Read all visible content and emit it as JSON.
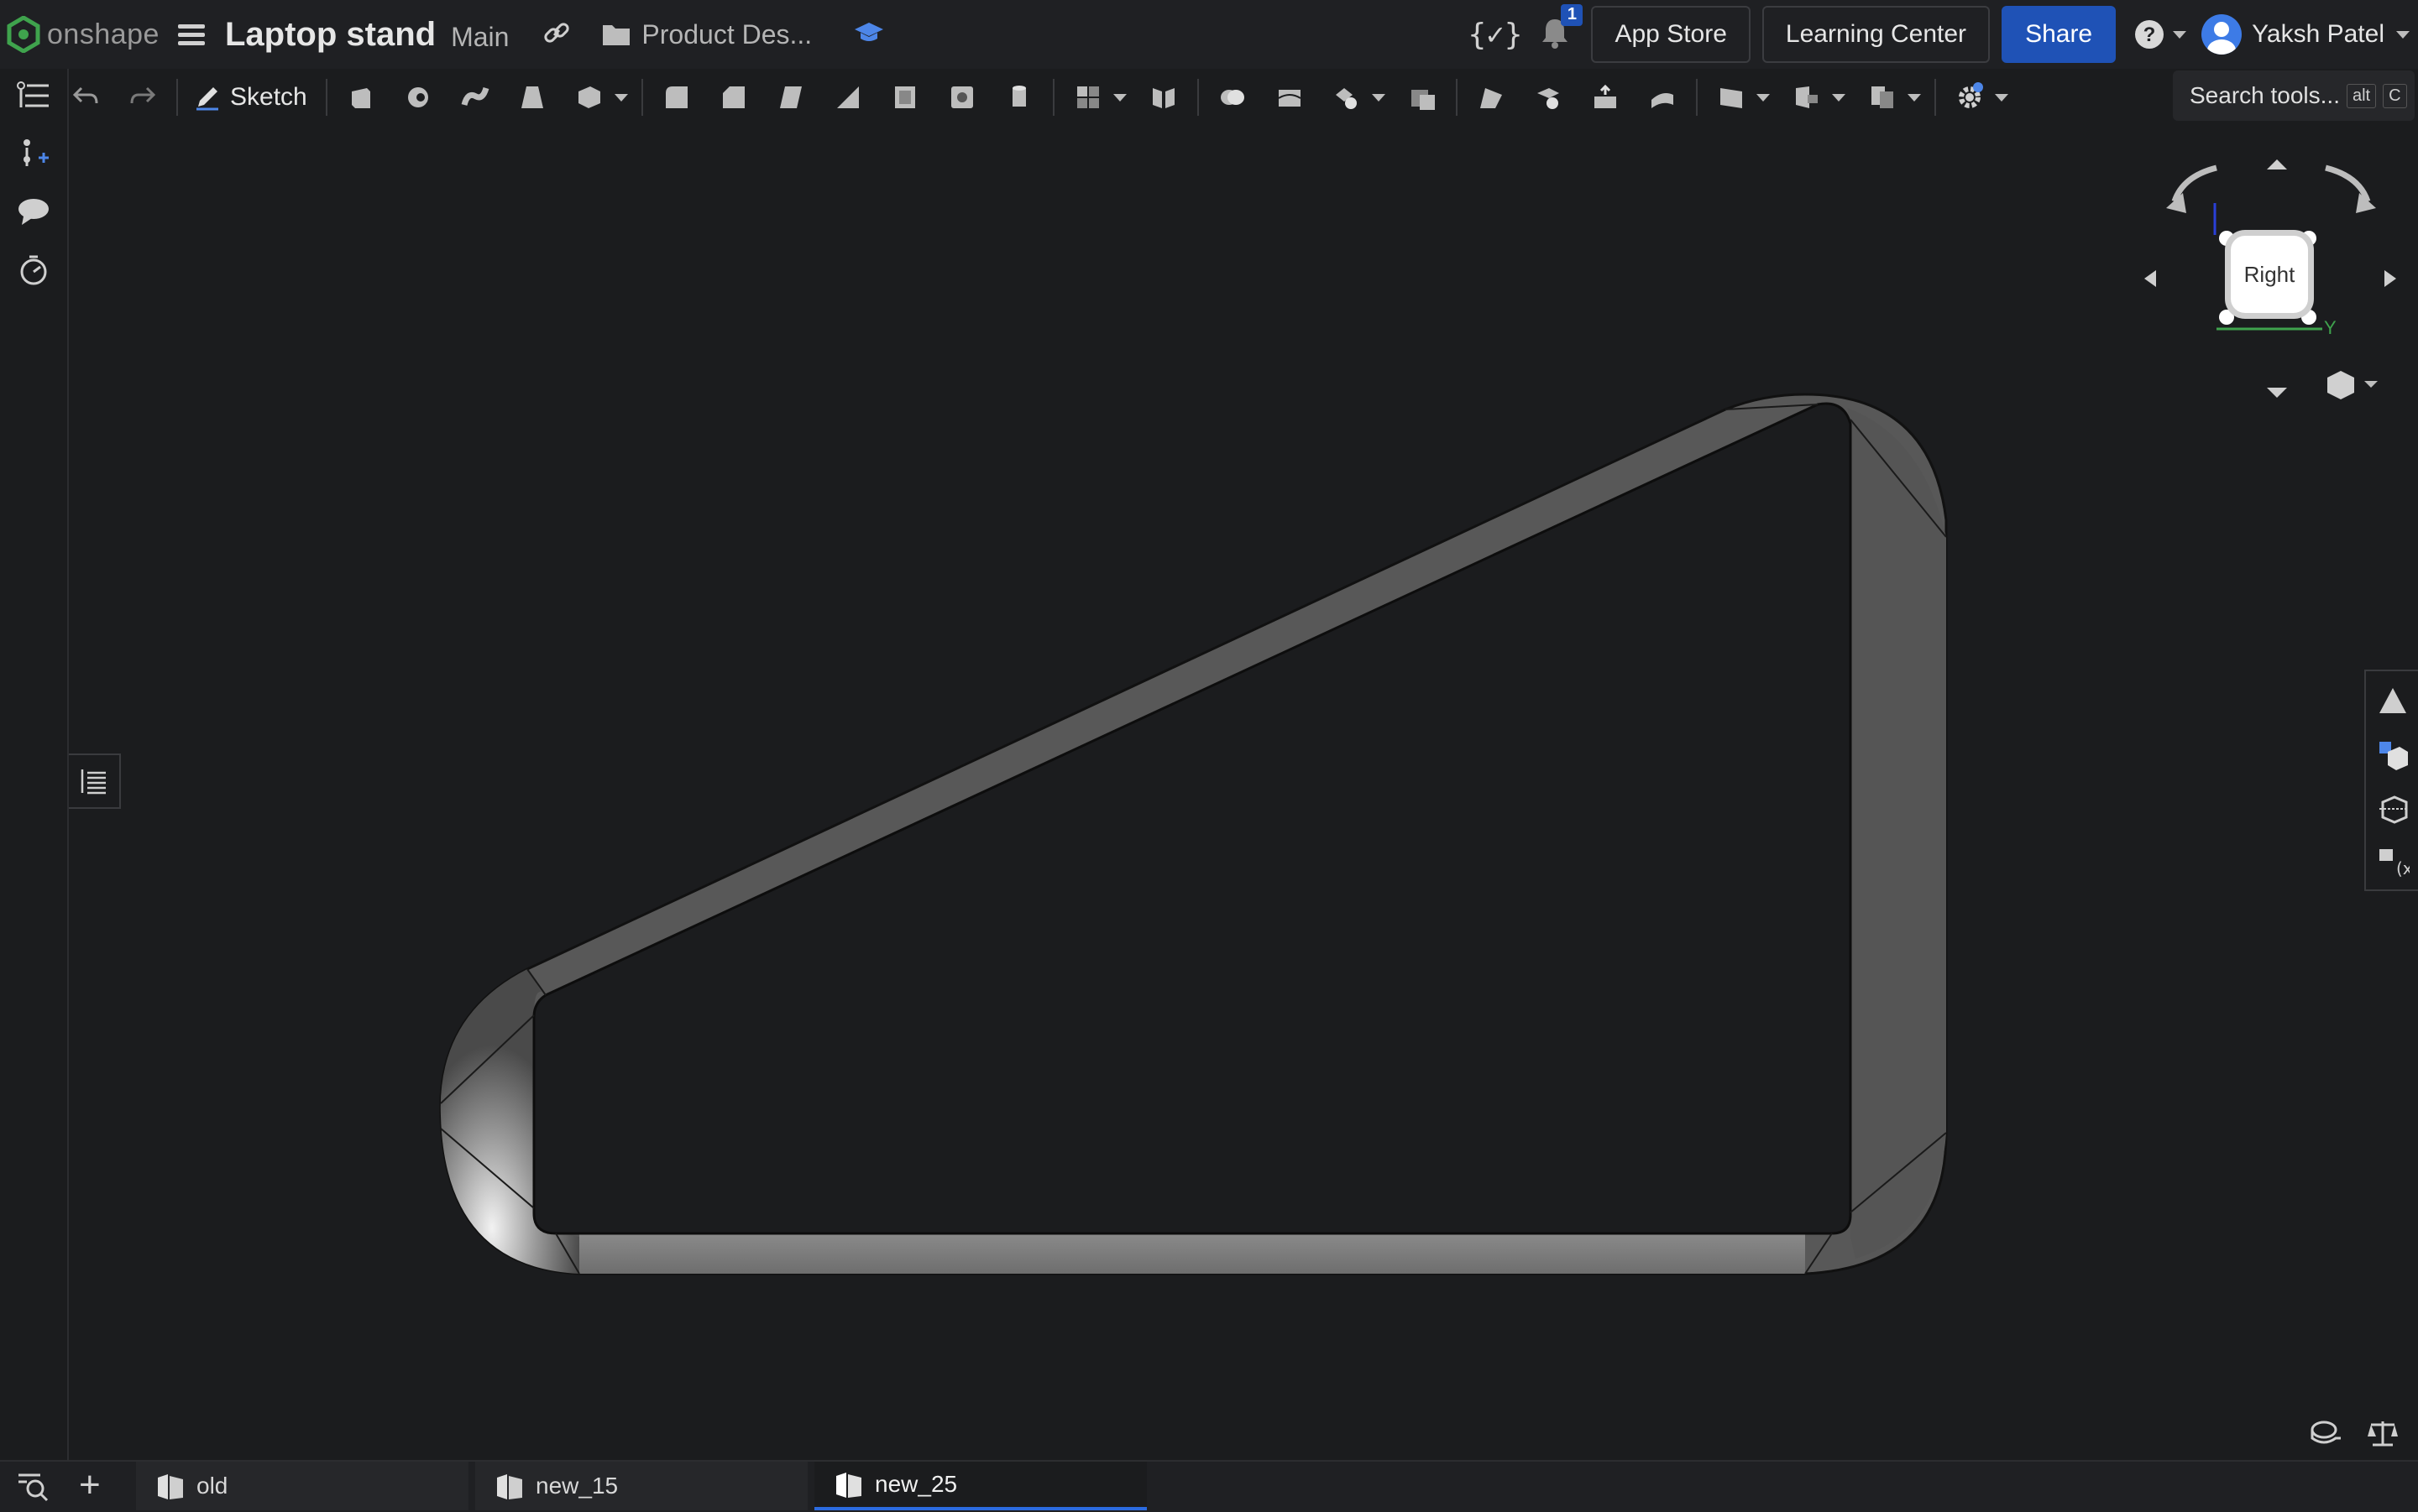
{
  "header": {
    "brand": "onshape",
    "document_title": "Laptop stand",
    "workspace": "Main",
    "folder": "Product Des...",
    "notification_count": "1",
    "app_store_label": "App Store",
    "learning_center_label": "Learning Center",
    "share_label": "Share",
    "user_name": "Yaksh Patel"
  },
  "toolbar": {
    "sketch_label": "Sketch",
    "search_placeholder": "Search tools...",
    "search_shortcut_mod": "alt",
    "search_shortcut_key": "C"
  },
  "viewcube": {
    "face_label": "Right",
    "axis_y": "Y"
  },
  "tabs": [
    {
      "label": "old",
      "active": false
    },
    {
      "label": "new_15",
      "active": false
    },
    {
      "label": "new_25",
      "active": true
    }
  ],
  "colors": {
    "accent": "#1f52b6",
    "background": "#1b1c1e",
    "part_face": "#5f5f5f",
    "active_tab_underline": "#2b6be0"
  }
}
